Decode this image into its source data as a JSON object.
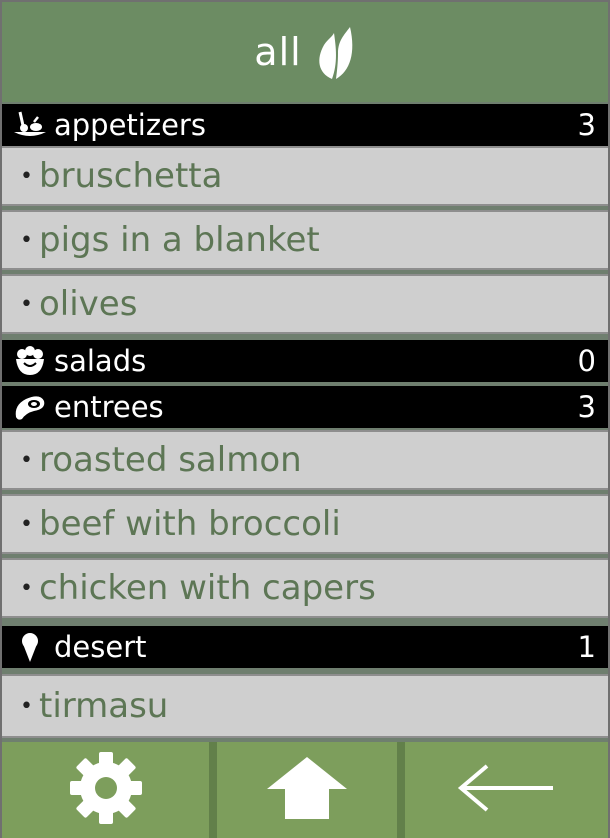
{
  "header": {
    "title": "all",
    "icon": "leaf-icon"
  },
  "categories": [
    {
      "label": "appetizers",
      "count": "3",
      "icon": "skewer-appetizer-icon",
      "items": [
        {
          "bullet": "•",
          "label": "bruschetta"
        },
        {
          "bullet": "•",
          "label": "pigs in a blanket"
        },
        {
          "bullet": "•",
          "label": "olives"
        }
      ]
    },
    {
      "label": "salads",
      "count": "0",
      "icon": "salad-bowl-icon",
      "items": []
    },
    {
      "label": "entrees",
      "count": "3",
      "icon": "steak-icon",
      "items": [
        {
          "bullet": "•",
          "label": "roasted salmon"
        },
        {
          "bullet": "•",
          "label": "beef with broccoli"
        },
        {
          "bullet": "•",
          "label": "chicken with capers"
        }
      ]
    },
    {
      "label": "desert",
      "count": "1",
      "icon": "ice-cream-icon",
      "items": [
        {
          "bullet": "•",
          "label": "tirmasu"
        }
      ]
    }
  ],
  "footer": {
    "buttons": [
      {
        "icon": "gear-icon"
      },
      {
        "icon": "home-icon"
      },
      {
        "icon": "back-arrow-icon"
      }
    ]
  },
  "colors": {
    "header_bg": "#6c8c63",
    "item_bg": "#cfcfcf",
    "item_text": "#5d7655",
    "category_bg": "#000000",
    "footer_bg": "#7d9e5c"
  }
}
